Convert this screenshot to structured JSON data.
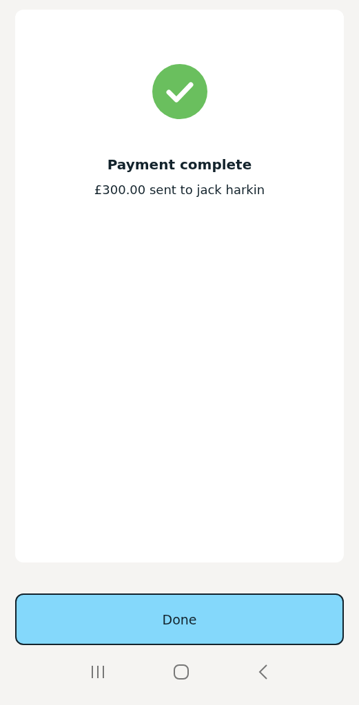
{
  "confirmation": {
    "title": "Payment complete",
    "message": "£300.00 sent to jack harkin"
  },
  "buttons": [
    "Done"
  ]
}
